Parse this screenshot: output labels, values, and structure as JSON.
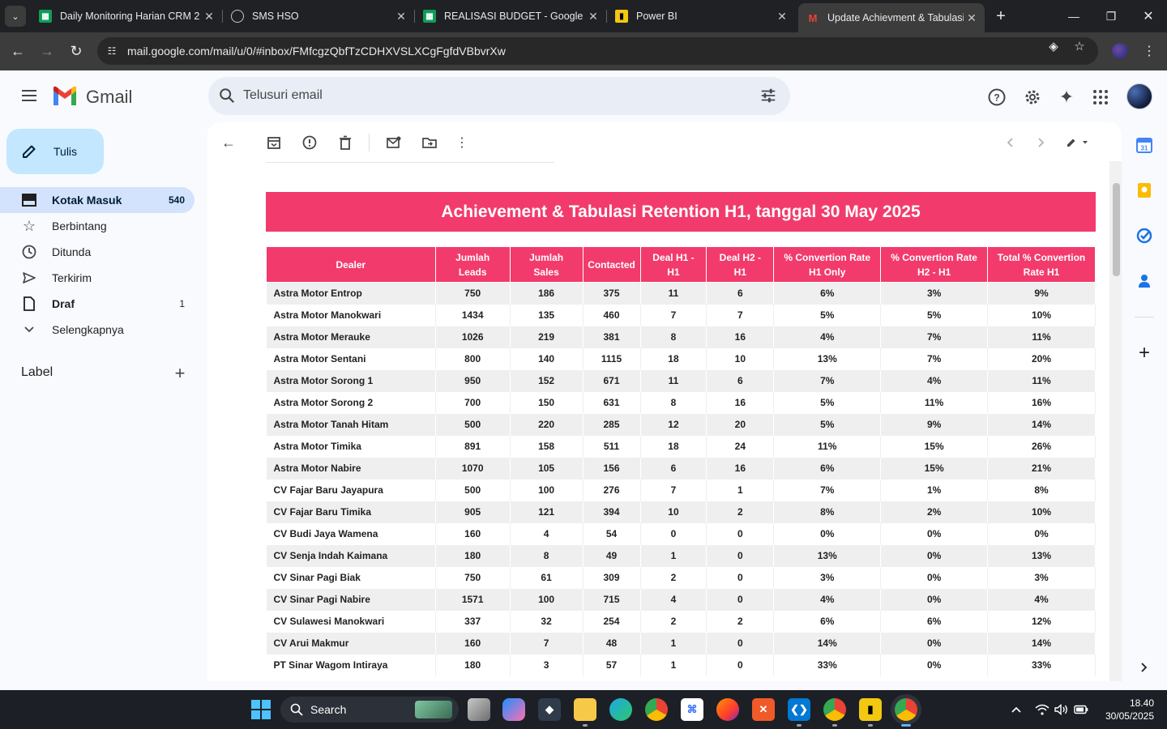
{
  "browser": {
    "tabs": [
      {
        "title": "Daily Monitoring Harian CRM 2",
        "favicon": "google-sheets-icon"
      },
      {
        "title": "SMS HSO",
        "favicon": "globe-icon"
      },
      {
        "title": "REALISASI BUDGET - Google Sp",
        "favicon": "google-sheets-icon"
      },
      {
        "title": "Power BI",
        "favicon": "power-bi-icon"
      },
      {
        "title": "Update Achievment & Tabulasi",
        "favicon": "gmail-icon",
        "active": true
      }
    ],
    "url": "mail.google.com/mail/u/0/#inbox/FMfcgzQbfTzCDHXVSLXCgFgfdVBbvrXw"
  },
  "gmail": {
    "brand": "Gmail",
    "search_placeholder": "Telusuri email",
    "compose_label": "Tulis",
    "nav": [
      {
        "label": "Kotak Masuk",
        "count": "540",
        "icon": "inbox-icon",
        "active": true
      },
      {
        "label": "Berbintang",
        "count": "",
        "icon": "star-icon"
      },
      {
        "label": "Ditunda",
        "count": "",
        "icon": "clock-icon"
      },
      {
        "label": "Terkirim",
        "count": "",
        "icon": "send-icon"
      },
      {
        "label": "Draf",
        "count": "1",
        "icon": "draft-icon",
        "bold": true
      },
      {
        "label": "Selengkapnya",
        "count": "",
        "icon": "chevron-down-icon"
      }
    ],
    "labels_heading": "Label"
  },
  "email": {
    "banner_title": "Achievement & Tabulasi Retention H1, tanggal 30 May 2025",
    "headers": {
      "dealer": "Dealer",
      "leads": [
        "Jumlah",
        "Leads"
      ],
      "sales": [
        "Jumlah",
        "Sales"
      ],
      "contacted": "Contacted",
      "deal_h1": [
        "Deal H1 -",
        "H1"
      ],
      "deal_h2": [
        "Deal H2 -",
        "H1"
      ],
      "cr_h1": [
        "% Convertion Rate",
        "H1 Only"
      ],
      "cr_h2": [
        "% Convertion Rate",
        "H2 - H1"
      ],
      "cr_total": [
        "Total % Convertion",
        "Rate H1"
      ]
    },
    "rows": [
      [
        "Astra Motor Entrop",
        "750",
        "186",
        "375",
        "11",
        "6",
        "6%",
        "3%",
        "9%"
      ],
      [
        "Astra Motor Manokwari",
        "1434",
        "135",
        "460",
        "7",
        "7",
        "5%",
        "5%",
        "10%"
      ],
      [
        "Astra Motor Merauke",
        "1026",
        "219",
        "381",
        "8",
        "16",
        "4%",
        "7%",
        "11%"
      ],
      [
        "Astra Motor Sentani",
        "800",
        "140",
        "1115",
        "18",
        "10",
        "13%",
        "7%",
        "20%"
      ],
      [
        "Astra Motor Sorong 1",
        "950",
        "152",
        "671",
        "11",
        "6",
        "7%",
        "4%",
        "11%"
      ],
      [
        "Astra Motor Sorong 2",
        "700",
        "150",
        "631",
        "8",
        "16",
        "5%",
        "11%",
        "16%"
      ],
      [
        "Astra Motor Tanah Hitam",
        "500",
        "220",
        "285",
        "12",
        "20",
        "5%",
        "9%",
        "14%"
      ],
      [
        "Astra Motor Timika",
        "891",
        "158",
        "511",
        "18",
        "24",
        "11%",
        "15%",
        "26%"
      ],
      [
        "Astra Motor Nabire",
        "1070",
        "105",
        "156",
        "6",
        "16",
        "6%",
        "15%",
        "21%"
      ],
      [
        "CV Fajar Baru Jayapura",
        "500",
        "100",
        "276",
        "7",
        "1",
        "7%",
        "1%",
        "8%"
      ],
      [
        "CV Fajar Baru Timika",
        "905",
        "121",
        "394",
        "10",
        "2",
        "8%",
        "2%",
        "10%"
      ],
      [
        "CV Budi Jaya Wamena",
        "160",
        "4",
        "54",
        "0",
        "0",
        "0%",
        "0%",
        "0%"
      ],
      [
        "CV Senja Indah Kaimana",
        "180",
        "8",
        "49",
        "1",
        "0",
        "13%",
        "0%",
        "13%"
      ],
      [
        "CV Sinar Pagi Biak",
        "750",
        "61",
        "309",
        "2",
        "0",
        "3%",
        "0%",
        "3%"
      ],
      [
        "CV Sinar Pagi Nabire",
        "1571",
        "100",
        "715",
        "4",
        "0",
        "4%",
        "0%",
        "4%"
      ],
      [
        "CV Sulawesi Manokwari",
        "337",
        "32",
        "254",
        "2",
        "2",
        "6%",
        "6%",
        "12%"
      ],
      [
        "CV Arui Makmur",
        "160",
        "7",
        "48",
        "1",
        "0",
        "14%",
        "0%",
        "14%"
      ],
      [
        "PT Sinar Wagom Intiraya",
        "180",
        "3",
        "57",
        "1",
        "0",
        "33%",
        "0%",
        "33%"
      ]
    ]
  },
  "taskbar": {
    "search_label": "Search",
    "time": "18.40",
    "date": "30/05/2025"
  },
  "colors": {
    "banner": "#f23b6c",
    "active_nav": "#d3e3fd",
    "compose": "#c2e7ff"
  }
}
